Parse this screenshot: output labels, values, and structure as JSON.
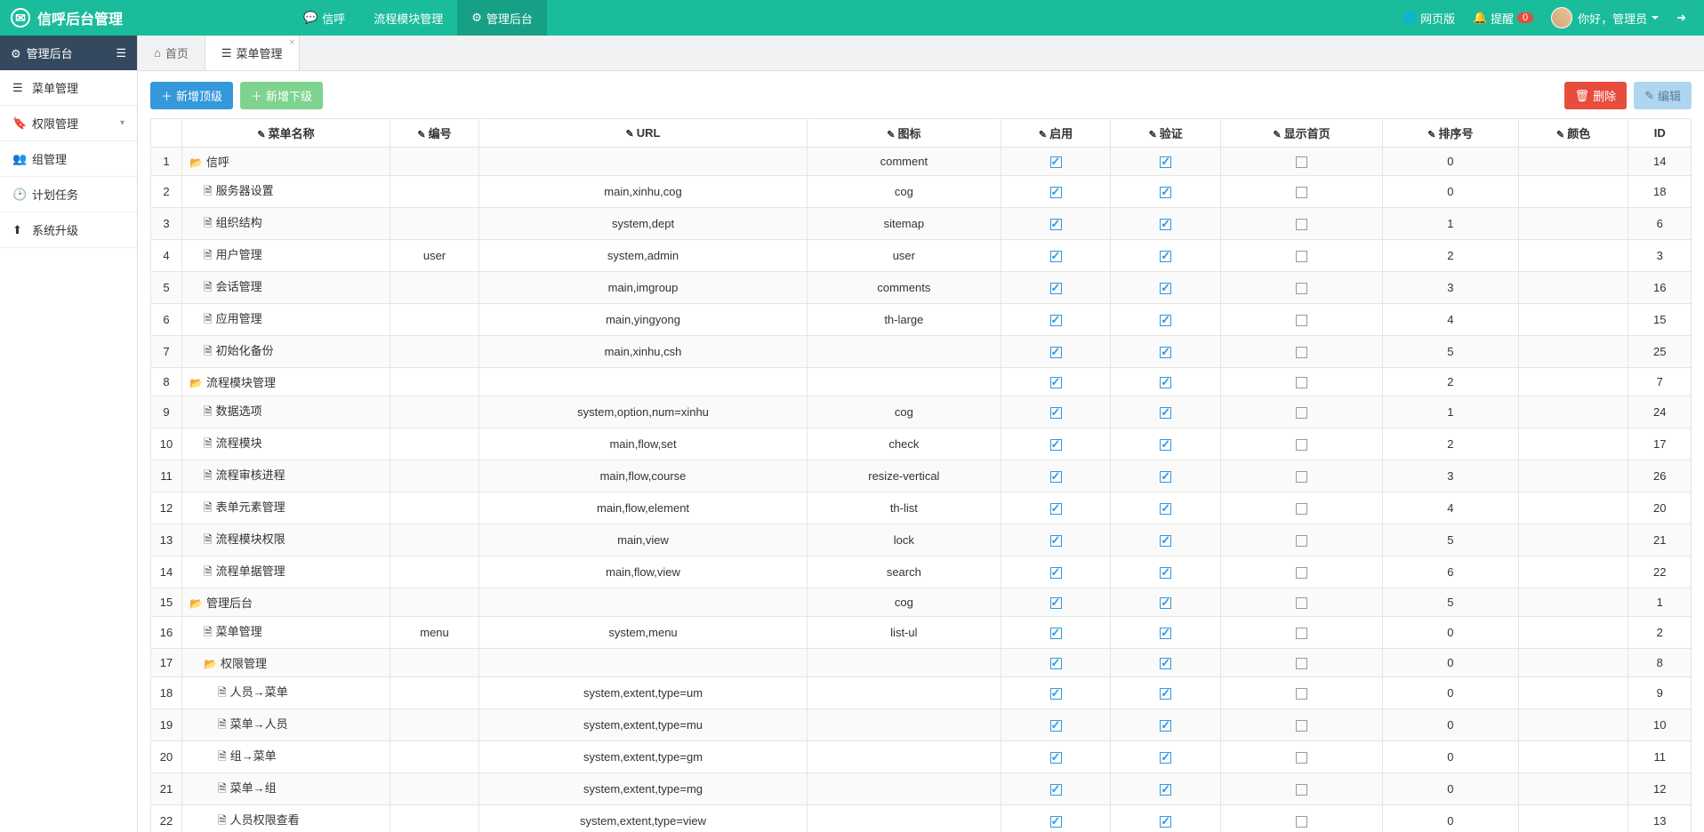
{
  "brand": "信呼后台管理",
  "topnav": {
    "items": [
      {
        "label": "信呼",
        "icon": "comment",
        "active": false
      },
      {
        "label": "流程模块管理",
        "icon": "",
        "active": false
      },
      {
        "label": "管理后台",
        "icon": "cog",
        "active": true
      }
    ],
    "web_label": "网页版",
    "remind_label": "提醒",
    "remind_count": "0",
    "user_greeting": "你好，管理员"
  },
  "sidebar": {
    "header": "管理后台",
    "items": [
      {
        "label": "菜单管理",
        "icon": "list"
      },
      {
        "label": "权限管理",
        "icon": "bookmark",
        "chevron": true
      },
      {
        "label": "组管理",
        "icon": "users"
      },
      {
        "label": "计划任务",
        "icon": "clock"
      },
      {
        "label": "系统升级",
        "icon": "upload"
      }
    ]
  },
  "tabs": [
    {
      "label": "首页",
      "icon": "home",
      "active": false,
      "closable": false
    },
    {
      "label": "菜单管理",
      "icon": "list",
      "active": true,
      "closable": true
    }
  ],
  "toolbar": {
    "add_top": "新增顶级",
    "add_sub": "新增下级",
    "delete": "删除",
    "edit": "编辑"
  },
  "table": {
    "headers": {
      "name": "菜单名称",
      "code": "编号",
      "url": "URL",
      "icon": "图标",
      "enable": "启用",
      "verify": "验证",
      "show_home": "显示首页",
      "sort": "排序号",
      "color": "颜色",
      "id": "ID"
    },
    "rows": [
      {
        "n": 1,
        "name": "信呼",
        "indent": 0,
        "type": "folder",
        "code": "",
        "url": "",
        "icon": "comment",
        "enable": true,
        "verify": true,
        "home": false,
        "sort": "0",
        "color": "",
        "id": "14"
      },
      {
        "n": 2,
        "name": "服务器设置",
        "indent": 1,
        "type": "file",
        "code": "",
        "url": "main,xinhu,cog",
        "icon": "cog",
        "enable": true,
        "verify": true,
        "home": false,
        "sort": "0",
        "color": "",
        "id": "18"
      },
      {
        "n": 3,
        "name": "组织结构",
        "indent": 1,
        "type": "file",
        "code": "",
        "url": "system,dept",
        "icon": "sitemap",
        "enable": true,
        "verify": true,
        "home": false,
        "sort": "1",
        "color": "",
        "id": "6"
      },
      {
        "n": 4,
        "name": "用户管理",
        "indent": 1,
        "type": "file",
        "code": "user",
        "url": "system,admin",
        "icon": "user",
        "enable": true,
        "verify": true,
        "home": false,
        "sort": "2",
        "color": "",
        "id": "3"
      },
      {
        "n": 5,
        "name": "会话管理",
        "indent": 1,
        "type": "file",
        "code": "",
        "url": "main,imgroup",
        "icon": "comments",
        "enable": true,
        "verify": true,
        "home": false,
        "sort": "3",
        "color": "",
        "id": "16"
      },
      {
        "n": 6,
        "name": "应用管理",
        "indent": 1,
        "type": "file",
        "code": "",
        "url": "main,yingyong",
        "icon": "th-large",
        "enable": true,
        "verify": true,
        "home": false,
        "sort": "4",
        "color": "",
        "id": "15"
      },
      {
        "n": 7,
        "name": "初始化备份",
        "indent": 1,
        "type": "file",
        "code": "",
        "url": "main,xinhu,csh",
        "icon": "",
        "enable": true,
        "verify": true,
        "home": false,
        "sort": "5",
        "color": "",
        "id": "25"
      },
      {
        "n": 8,
        "name": "流程模块管理",
        "indent": 0,
        "type": "folder",
        "code": "",
        "url": "",
        "icon": "",
        "enable": true,
        "verify": true,
        "home": false,
        "sort": "2",
        "color": "",
        "id": "7"
      },
      {
        "n": 9,
        "name": "数据选项",
        "indent": 1,
        "type": "file",
        "code": "",
        "url": "system,option,num=xinhu",
        "icon": "cog",
        "enable": true,
        "verify": true,
        "home": false,
        "sort": "1",
        "color": "",
        "id": "24"
      },
      {
        "n": 10,
        "name": "流程模块",
        "indent": 1,
        "type": "file",
        "code": "",
        "url": "main,flow,set",
        "icon": "check",
        "enable": true,
        "verify": true,
        "home": false,
        "sort": "2",
        "color": "",
        "id": "17"
      },
      {
        "n": 11,
        "name": "流程审核进程",
        "indent": 1,
        "type": "file",
        "code": "",
        "url": "main,flow,course",
        "icon": "resize-vertical",
        "enable": true,
        "verify": true,
        "home": false,
        "sort": "3",
        "color": "",
        "id": "26"
      },
      {
        "n": 12,
        "name": "表单元素管理",
        "indent": 1,
        "type": "file",
        "code": "",
        "url": "main,flow,element",
        "icon": "th-list",
        "enable": true,
        "verify": true,
        "home": false,
        "sort": "4",
        "color": "",
        "id": "20"
      },
      {
        "n": 13,
        "name": "流程模块权限",
        "indent": 1,
        "type": "file",
        "code": "",
        "url": "main,view",
        "icon": "lock",
        "enable": true,
        "verify": true,
        "home": false,
        "sort": "5",
        "color": "",
        "id": "21"
      },
      {
        "n": 14,
        "name": "流程单据管理",
        "indent": 1,
        "type": "file",
        "code": "",
        "url": "main,flow,view",
        "icon": "search",
        "enable": true,
        "verify": true,
        "home": false,
        "sort": "6",
        "color": "",
        "id": "22"
      },
      {
        "n": 15,
        "name": "管理后台",
        "indent": 0,
        "type": "folder",
        "code": "",
        "url": "",
        "icon": "cog",
        "enable": true,
        "verify": true,
        "home": false,
        "sort": "5",
        "color": "",
        "id": "1"
      },
      {
        "n": 16,
        "name": "菜单管理",
        "indent": 1,
        "type": "file",
        "code": "menu",
        "url": "system,menu",
        "icon": "list-ul",
        "enable": true,
        "verify": true,
        "home": false,
        "sort": "0",
        "color": "",
        "id": "2"
      },
      {
        "n": 17,
        "name": "权限管理",
        "indent": 1,
        "type": "folder",
        "code": "",
        "url": "",
        "icon": "",
        "enable": true,
        "verify": true,
        "home": false,
        "sort": "0",
        "color": "",
        "id": "8"
      },
      {
        "n": 18,
        "name": "人员→菜单",
        "indent": 2,
        "type": "file",
        "code": "",
        "url": "system,extent,type=um",
        "icon": "",
        "enable": true,
        "verify": true,
        "home": false,
        "sort": "0",
        "color": "",
        "id": "9"
      },
      {
        "n": 19,
        "name": "菜单→人员",
        "indent": 2,
        "type": "file",
        "code": "",
        "url": "system,extent,type=mu",
        "icon": "",
        "enable": true,
        "verify": true,
        "home": false,
        "sort": "0",
        "color": "",
        "id": "10"
      },
      {
        "n": 20,
        "name": "组→菜单",
        "indent": 2,
        "type": "file",
        "code": "",
        "url": "system,extent,type=gm",
        "icon": "",
        "enable": true,
        "verify": true,
        "home": false,
        "sort": "0",
        "color": "",
        "id": "11"
      },
      {
        "n": 21,
        "name": "菜单→组",
        "indent": 2,
        "type": "file",
        "code": "",
        "url": "system,extent,type=mg",
        "icon": "",
        "enable": true,
        "verify": true,
        "home": false,
        "sort": "0",
        "color": "",
        "id": "12"
      },
      {
        "n": 22,
        "name": "人员权限查看",
        "indent": 2,
        "type": "file",
        "code": "",
        "url": "system,extent,type=view",
        "icon": "",
        "enable": true,
        "verify": true,
        "home": false,
        "sort": "0",
        "color": "",
        "id": "13"
      }
    ]
  }
}
